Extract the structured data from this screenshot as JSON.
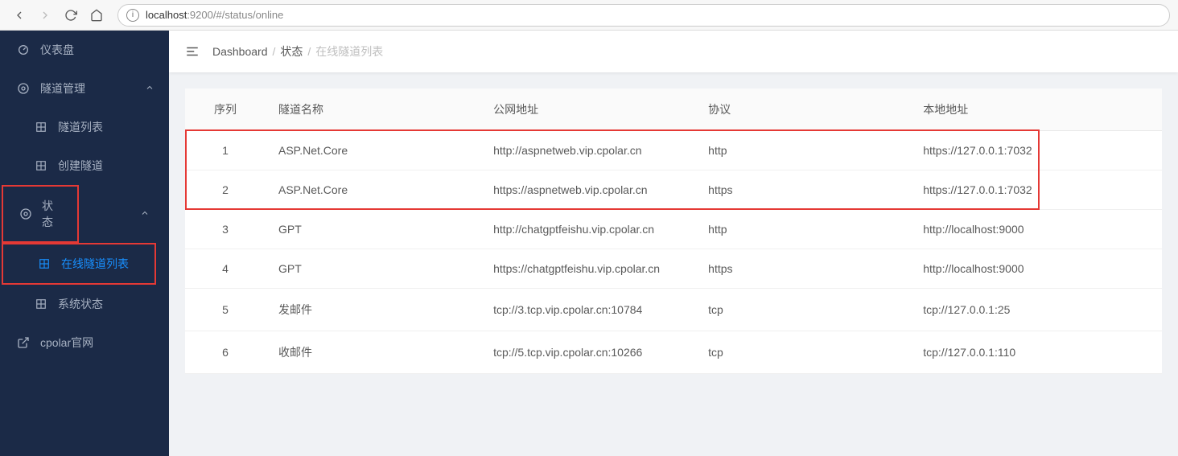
{
  "browser": {
    "host": "localhost",
    "port": ":9200",
    "path": "/#/status/online"
  },
  "sidebar": {
    "items": [
      {
        "label": "仪表盘"
      },
      {
        "label": "隧道管理"
      },
      {
        "label": "隧道列表"
      },
      {
        "label": "创建隧道"
      },
      {
        "label": "状态"
      },
      {
        "label": "在线隧道列表"
      },
      {
        "label": "系统状态"
      },
      {
        "label": "cpolar官网"
      }
    ]
  },
  "breadcrumb": {
    "items": [
      "Dashboard",
      "状态",
      "在线隧道列表"
    ]
  },
  "table": {
    "headers": [
      "序列",
      "隧道名称",
      "公网地址",
      "协议",
      "本地地址"
    ],
    "rows": [
      {
        "seq": "1",
        "name": "ASP.Net.Core",
        "public": "http://aspnetweb.vip.cpolar.cn",
        "proto": "http",
        "local": "https://127.0.0.1:7032"
      },
      {
        "seq": "2",
        "name": "ASP.Net.Core",
        "public": "https://aspnetweb.vip.cpolar.cn",
        "proto": "https",
        "local": "https://127.0.0.1:7032"
      },
      {
        "seq": "3",
        "name": "GPT",
        "public": "http://chatgptfeishu.vip.cpolar.cn",
        "proto": "http",
        "local": "http://localhost:9000"
      },
      {
        "seq": "4",
        "name": "GPT",
        "public": "https://chatgptfeishu.vip.cpolar.cn",
        "proto": "https",
        "local": "http://localhost:9000"
      },
      {
        "seq": "5",
        "name": "发邮件",
        "public": "tcp://3.tcp.vip.cpolar.cn:10784",
        "proto": "tcp",
        "local": "tcp://127.0.0.1:25"
      },
      {
        "seq": "6",
        "name": "收邮件",
        "public": "tcp://5.tcp.vip.cpolar.cn:10266",
        "proto": "tcp",
        "local": "tcp://127.0.0.1:110"
      }
    ]
  }
}
